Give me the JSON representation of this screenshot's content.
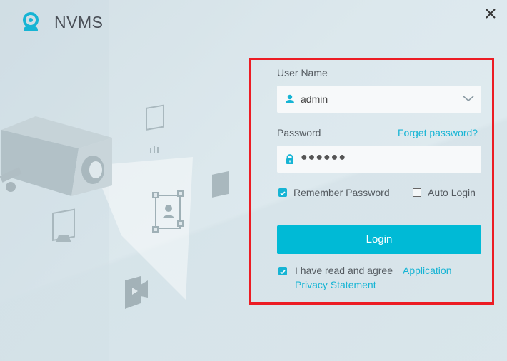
{
  "app": {
    "title": "NVMS",
    "close_label": "close"
  },
  "form": {
    "username_label": "User Name",
    "username_value": "admin",
    "password_label": "Password",
    "forget_password": "Forget password?",
    "password_masked": "●●●●●●",
    "remember_password": {
      "label": "Remember Password",
      "checked": true
    },
    "auto_login": {
      "label": "Auto Login",
      "checked": false
    },
    "login_button": "Login",
    "agree": {
      "text": "I have read and agree",
      "link_line1": "Application",
      "link_line2": "Privacy Statement",
      "checked": true
    }
  },
  "colors": {
    "accent": "#00bad6",
    "link": "#16b4d4",
    "highlight_frame": "#ec1c24"
  },
  "decor_icons": [
    "security-camera-illustration",
    "chart-icon",
    "face-recognition-icon",
    "car-recognition-icon",
    "film-icon",
    "video-camera-icon"
  ]
}
